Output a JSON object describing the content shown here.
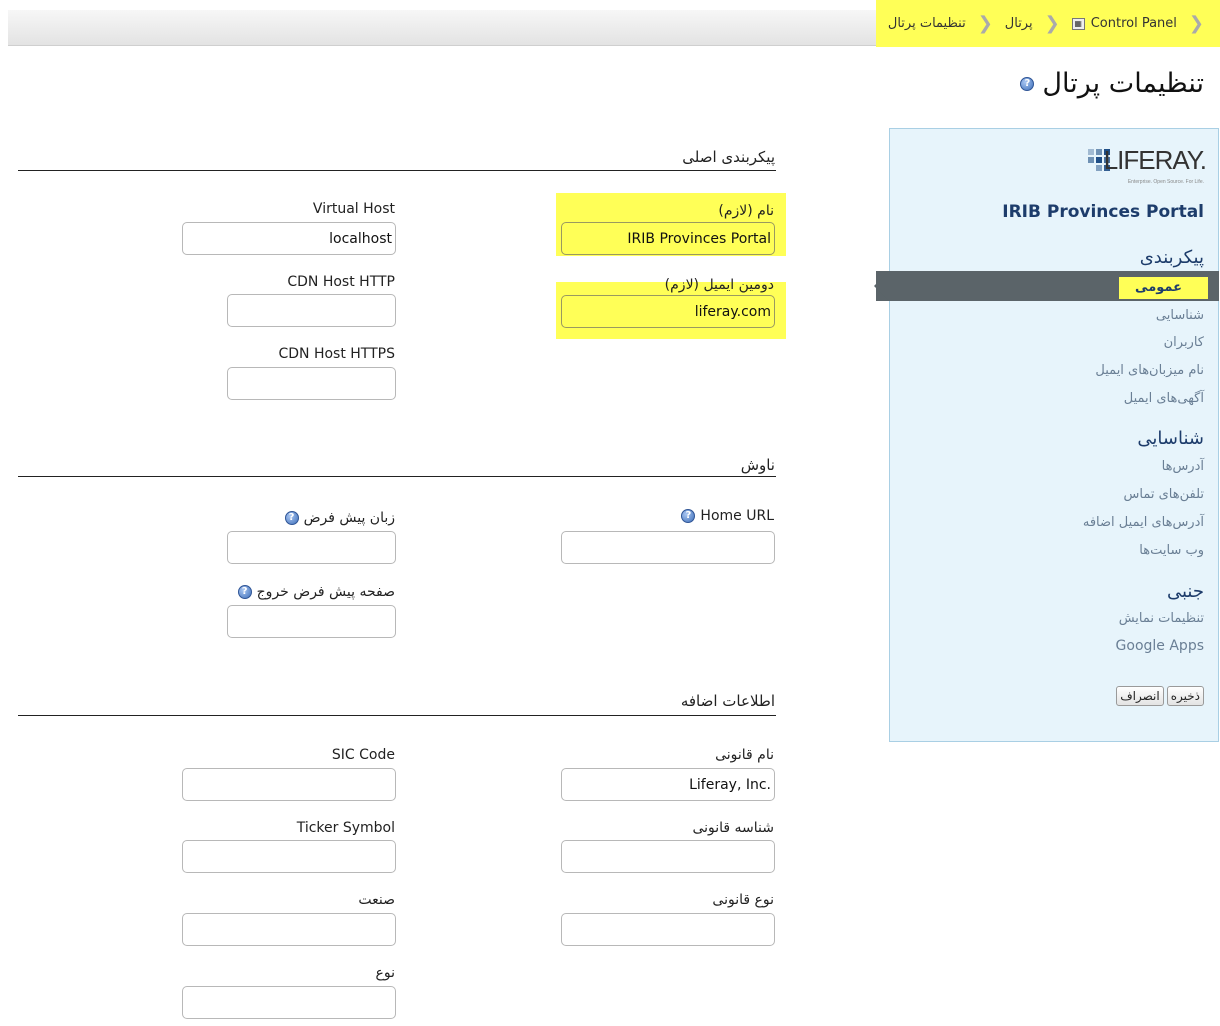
{
  "breadcrumb": {
    "items": [
      {
        "label": "Control Panel",
        "icon": "control-panel-icon"
      },
      {
        "label": "پرتال"
      },
      {
        "label": "تنظیمات پرتال"
      }
    ]
  },
  "page": {
    "title": "تنظیمات پرتال"
  },
  "sidebar": {
    "logo_text": "LIFERAY.",
    "logo_tagline": "Enterprise. Open Source. For Life.",
    "portal_name": "IRIB Provinces Portal",
    "sections": [
      {
        "title": "پیکربندی",
        "items": [
          "عمومی",
          "شناسایی",
          "کاربران",
          "نام میزبان‌های ایمیل",
          "آگهی‌های ایمیل"
        ],
        "active": "عمومی"
      },
      {
        "title": "شناسایی",
        "items": [
          "آدرس‌ها",
          "تلفن‌های تماس",
          "آدرس‌های ایمیل اضافه",
          "وب سایت‌ها"
        ]
      },
      {
        "title": "جنبی",
        "items": [
          "تنظیمات نمایش",
          "Google Apps"
        ]
      }
    ],
    "buttons": {
      "save": "ذخیره",
      "cancel": "انصراف"
    }
  },
  "form": {
    "main_config": {
      "title": "پیکربندی اصلی",
      "name_label": "نام (لازم)",
      "name_value": "IRIB Provinces Portal",
      "mail_domain_label": "دومین ایمیل (لازم)",
      "mail_domain_value": "liferay.com",
      "virtual_host_label": "Virtual Host",
      "virtual_host_value": "localhost",
      "cdn_http_label": "CDN Host HTTP",
      "cdn_http_value": "",
      "cdn_https_label": "CDN Host HTTPS",
      "cdn_https_value": ""
    },
    "navigation": {
      "title": "ناوش",
      "home_url_label": "Home URL",
      "home_url_value": "",
      "default_landing_label": "زبان پیش فرض",
      "default_landing_value": "",
      "default_logout_label": "صفحه پیش فرض خروج",
      "default_logout_value": ""
    },
    "additional_info": {
      "title": "اطلاعات اضافه",
      "legal_name_label": "نام قانونی",
      "legal_name_value": "Liferay, Inc.",
      "legal_id_label": "شناسه قانونی",
      "legal_id_value": "",
      "legal_type_label": "نوع قانونی",
      "legal_type_value": "",
      "sic_code_label": "SIC Code",
      "sic_code_value": "",
      "ticker_label": "Ticker Symbol",
      "ticker_value": "",
      "industry_label": "صنعت",
      "industry_value": "",
      "type_label": "نوع",
      "type_value": ""
    }
  },
  "colors": {
    "highlight": "#ffff57",
    "sidebar_bg": "#e7f4fb",
    "sidebar_active": "#5b6469",
    "link": "#6a7f95",
    "heading": "#1d3c6b"
  }
}
